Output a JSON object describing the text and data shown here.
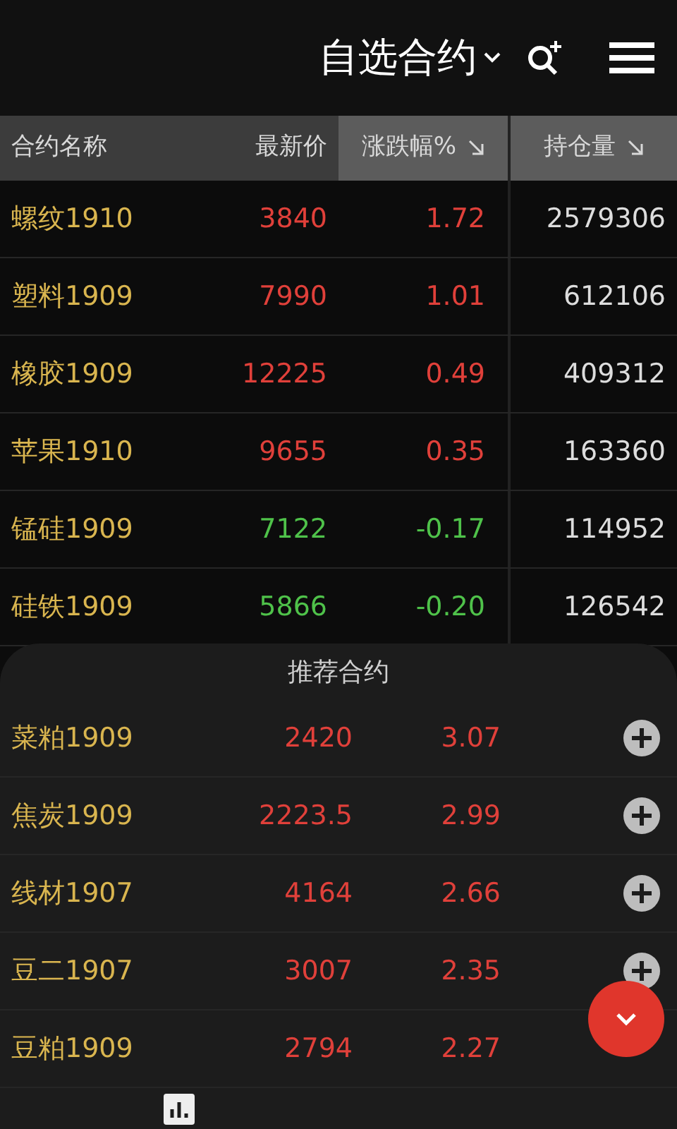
{
  "header": {
    "title": "自选合约"
  },
  "columns": [
    {
      "label": "合约名称",
      "sorted": false
    },
    {
      "label": "最新价",
      "sorted": false
    },
    {
      "label": "涨跌幅%",
      "sorted": true
    },
    {
      "label": "持仓量",
      "sorted": true
    }
  ],
  "rows": [
    {
      "name": "螺纹1910",
      "price": "3840",
      "change": "1.72",
      "holdings": "2579306",
      "rising": true
    },
    {
      "name": "塑料1909",
      "price": "7990",
      "change": "1.01",
      "holdings": "612106",
      "rising": true
    },
    {
      "name": "橡胶1909",
      "price": "12225",
      "change": "0.49",
      "holdings": "409312",
      "rising": true
    },
    {
      "name": "苹果1910",
      "price": "9655",
      "change": "0.35",
      "holdings": "163360",
      "rising": true
    },
    {
      "name": "锰硅1909",
      "price": "7122",
      "change": "-0.17",
      "holdings": "114952",
      "rising": false
    },
    {
      "name": "硅铁1909",
      "price": "5866",
      "change": "-0.20",
      "holdings": "126542",
      "rising": false
    }
  ],
  "recommended": {
    "title": "推荐合约",
    "rows": [
      {
        "name": "菜粕1909",
        "price": "2420",
        "change": "3.07",
        "rising": true
      },
      {
        "name": "焦炭1909",
        "price": "2223.5",
        "change": "2.99",
        "rising": true
      },
      {
        "name": "线材1907",
        "price": "4164",
        "change": "2.66",
        "rising": true
      },
      {
        "name": "豆二1907",
        "price": "3007",
        "change": "2.35",
        "rising": true
      },
      {
        "name": "豆粕1909",
        "price": "2794",
        "change": "2.27",
        "rising": true
      }
    ]
  }
}
